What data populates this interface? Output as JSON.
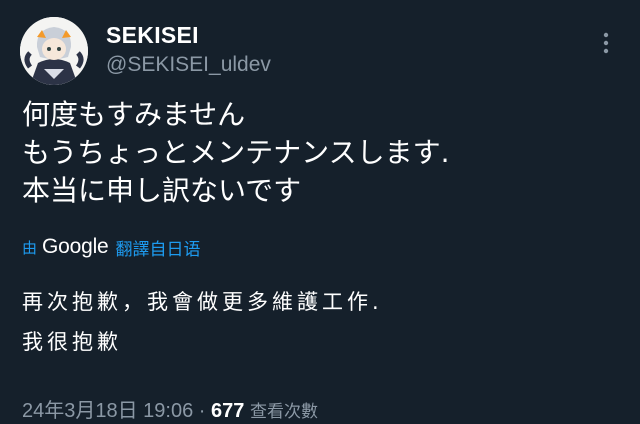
{
  "author": {
    "display_name": "SEKISEI",
    "handle": "@SEKISEI_uldev"
  },
  "tweet": {
    "lines": [
      "何度もすみません",
      "もうちょっとメンテナンスします.",
      "本当に申し訳ないです"
    ]
  },
  "translation_bar": {
    "by": "由",
    "provider": "Google",
    "action": "翻譯自日语"
  },
  "translation": {
    "lines": [
      "再次抱歉，我會做更多維護工作.",
      "我很抱歉"
    ]
  },
  "meta": {
    "timestamp": "24年3月18日 19:06",
    "separator": " · ",
    "views_count": "677",
    "views_label": "查看次數"
  },
  "icons": {
    "avatar": "avatar-image",
    "more": "more-options-icon"
  },
  "colors": {
    "background": "#15202b",
    "secondary_text": "#8b98a5",
    "accent": "#1d9bf0"
  }
}
